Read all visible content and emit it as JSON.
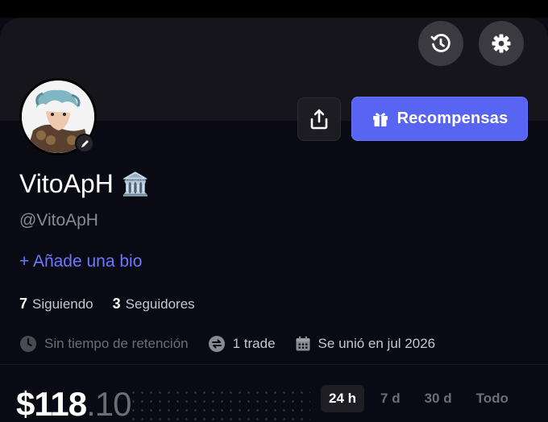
{
  "header": {
    "history_icon": "history-icon",
    "settings_icon": "gear-icon"
  },
  "profile": {
    "display_name": "VitoApH",
    "badge": "🏛️",
    "handle": "@VitoApH",
    "add_bio": "+ Añade una bio"
  },
  "actions": {
    "share_icon": "share-icon",
    "rewards_label": "Recompensas",
    "rewards_color": "#5865f2"
  },
  "follow": {
    "following_count": "7",
    "following_label": "Siguiendo",
    "followers_count": "3",
    "followers_label": "Seguidores"
  },
  "meta": {
    "retention": "Sin tiempo de retención",
    "trades": "1 trade",
    "joined": "Se unió en jul 2026"
  },
  "portfolio": {
    "value_main": "$118",
    "value_cents": ".10",
    "ranges": [
      "24 h",
      "7 d",
      "30 d",
      "Todo"
    ],
    "selected_range": "24 h"
  }
}
